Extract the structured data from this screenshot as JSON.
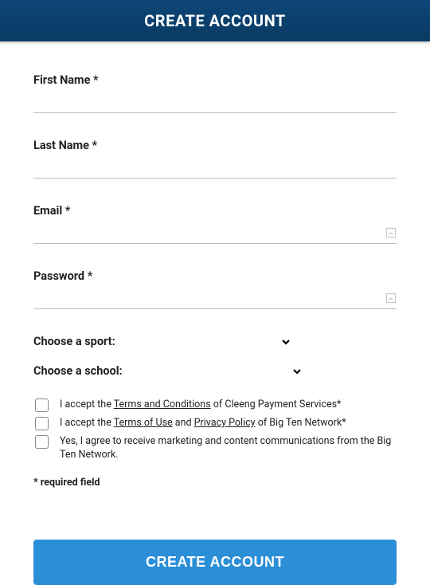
{
  "header": {
    "title": "CREATE ACCOUNT"
  },
  "fields": {
    "first_name": {
      "label": "First Name *",
      "value": ""
    },
    "last_name": {
      "label": "Last Name *",
      "value": ""
    },
    "email": {
      "label": "Email *",
      "value": ""
    },
    "password": {
      "label": "Password *",
      "value": ""
    }
  },
  "dropdowns": {
    "sport": {
      "label": "Choose a sport:"
    },
    "school": {
      "label": "Choose a school:"
    }
  },
  "consents": {
    "terms_prefix": "I accept the ",
    "terms_link": "Terms and Conditions",
    "terms_suffix": " of Cleeng Payment Services*",
    "tou_prefix": "I accept the ",
    "tou_link": "Terms of Use",
    "tou_mid": " and ",
    "pp_link": "Privacy Policy",
    "tou_suffix": " of Big Ten Network*",
    "marketing": "Yes, I agree to receive marketing and content communications from the Big Ten Network."
  },
  "required_note": "* required field",
  "submit": {
    "label": "CREATE ACCOUNT"
  }
}
